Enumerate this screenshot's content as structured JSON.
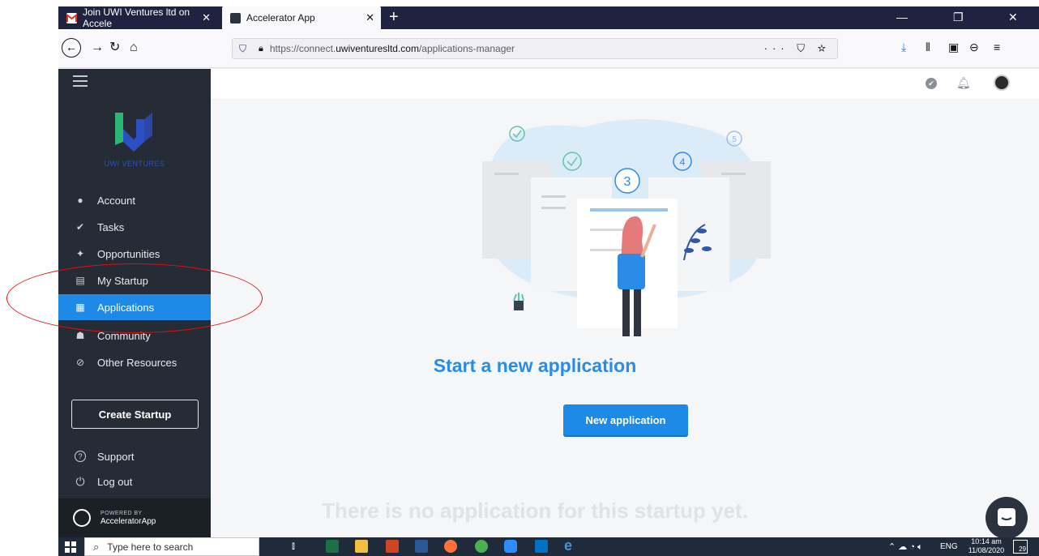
{
  "browser": {
    "tabs": [
      {
        "title": "Join UWI Ventures ltd on Accele",
        "active": false
      },
      {
        "title": "Accelerator App",
        "active": true
      }
    ],
    "url": {
      "scheme": "https://connect.",
      "host": "uwiventuresltd.com",
      "path": "/applications-manager"
    },
    "page_actions": "··· ⛉ ☆"
  },
  "app": {
    "brand": "UWI VENTURES",
    "menu": [
      {
        "label": "Account",
        "icon": "person-icon",
        "glyph": "●"
      },
      {
        "label": "Tasks",
        "icon": "check-circle-icon",
        "glyph": "✔"
      },
      {
        "label": "Opportunities",
        "icon": "megaphone-icon",
        "glyph": "✦"
      },
      {
        "label": "My Startup",
        "icon": "document-icon",
        "glyph": "▤"
      },
      {
        "label": "Applications",
        "icon": "id-card-icon",
        "glyph": "▦",
        "active": true
      },
      {
        "label": "Community",
        "icon": "people-icon",
        "glyph": "☗"
      },
      {
        "label": "Other Resources",
        "icon": "link-icon",
        "glyph": "⊘"
      }
    ],
    "create_startup": "Create Startup",
    "support": "Support",
    "logout": "Log out",
    "powered_by": "POWERED BY",
    "powered_name": "AcceleratorApp",
    "main": {
      "heading": "Start a new application",
      "button": "New application",
      "empty_message": "There is no application for this startup yet."
    },
    "illustration_steps": [
      "3",
      "4",
      "5"
    ]
  },
  "taskbar": {
    "search_placeholder": "Type here to search",
    "language": "ENG",
    "time": "10:14 am",
    "date": "11/08/2020",
    "notification_count": "29"
  },
  "colors": {
    "accent": "#1e8ae8",
    "sidebar": "#262c35",
    "annotation": "#e01010"
  }
}
